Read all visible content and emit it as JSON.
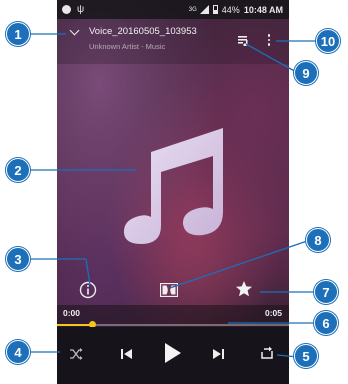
{
  "status_bar": {
    "signal_label": "3G",
    "battery": "44%",
    "time": "10:48 AM"
  },
  "track": {
    "title": "Voice_20160505_103953",
    "subtitle": "Unknown Artist - Music"
  },
  "playback": {
    "current_time": "0:00",
    "total_time": "0:05",
    "progress": 0.15
  },
  "colors": {
    "callout": "#1c6fb8",
    "progress": "#f5c518"
  },
  "icons": {
    "collapse": "chevron-down-icon",
    "queue": "playlist-icon",
    "more": "more-vert-icon",
    "info": "info-icon",
    "audio_effects": "dolby-icon",
    "favorite": "star-icon",
    "shuffle": "shuffle-icon",
    "previous": "skip-previous-icon",
    "play": "play-icon",
    "next": "skip-next-icon",
    "repeat": "repeat-icon"
  },
  "callouts": [
    {
      "label": "1"
    },
    {
      "label": "2"
    },
    {
      "label": "3"
    },
    {
      "label": "4"
    },
    {
      "label": "5"
    },
    {
      "label": "6"
    },
    {
      "label": "7"
    },
    {
      "label": "8"
    },
    {
      "label": "9"
    },
    {
      "label": "10"
    }
  ]
}
